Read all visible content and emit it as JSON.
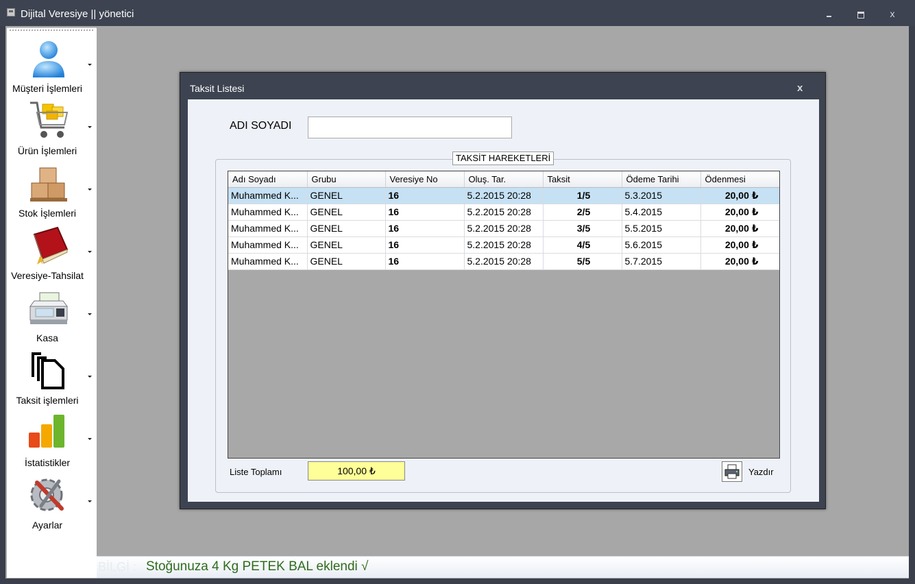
{
  "window": {
    "title": "Dijital Veresiye  ||  yönetici",
    "minimize": "",
    "maximize": "",
    "close": "x"
  },
  "sidebar": {
    "items": [
      {
        "label": "Müşteri İşlemleri",
        "icon": "user-icon"
      },
      {
        "label": "Ürün İşlemleri",
        "icon": "shopping-cart-icon"
      },
      {
        "label": "Stok İşlemleri",
        "icon": "boxes-icon"
      },
      {
        "label": "Veresiye-Tahsilat",
        "icon": "book-icon"
      },
      {
        "label": "Kasa",
        "icon": "cash-register-icon"
      },
      {
        "label": "Taksit işlemleri",
        "icon": "documents-icon"
      },
      {
        "label": "İstatistikler",
        "icon": "bar-chart-icon"
      },
      {
        "label": "Ayarlar",
        "icon": "settings-icon"
      }
    ]
  },
  "dialog": {
    "title": "Taksit Listesi",
    "close": "x",
    "name_label": "ADI SOYADI",
    "name_value": "",
    "group_title": "TAKSİT HAREKETLERİ",
    "columns": [
      "Adı Soyadı",
      "Grubu",
      "Veresiye No",
      "Oluş. Tar.",
      "Taksit",
      "Ödeme Tarihi",
      "Ödenmesi"
    ],
    "rows": [
      [
        "Muhammed K...",
        "GENEL",
        "16",
        "5.2.2015 20:28",
        "1/5",
        "5.3.2015",
        "20,00 ₺"
      ],
      [
        "Muhammed K...",
        "GENEL",
        "16",
        "5.2.2015 20:28",
        "2/5",
        "5.4.2015",
        "20,00 ₺"
      ],
      [
        "Muhammed K...",
        "GENEL",
        "16",
        "5.2.2015 20:28",
        "3/5",
        "5.5.2015",
        "20,00 ₺"
      ],
      [
        "Muhammed K...",
        "GENEL",
        "16",
        "5.2.2015 20:28",
        "4/5",
        "5.6.2015",
        "20,00 ₺"
      ],
      [
        "Muhammed K...",
        "GENEL",
        "16",
        "5.2.2015 20:28",
        "5/5",
        "5.7.2015",
        "20,00 ₺"
      ]
    ],
    "selected_row": 0,
    "total_label": "Liste Toplamı",
    "total_value": "100,00 ₺",
    "print_label": "Yazdır"
  },
  "statusbar": {
    "prefix": "BİLGİ :",
    "message": "Stoğunuza 4 Kg PETEK BAL eklendi  √"
  },
  "colors": {
    "titlebar": "#3d4350",
    "workarea": "#a7a7a7",
    "selected_row": "#c6e1f4",
    "total_box": "#ffff99",
    "status_text": "#2f6b1e"
  }
}
